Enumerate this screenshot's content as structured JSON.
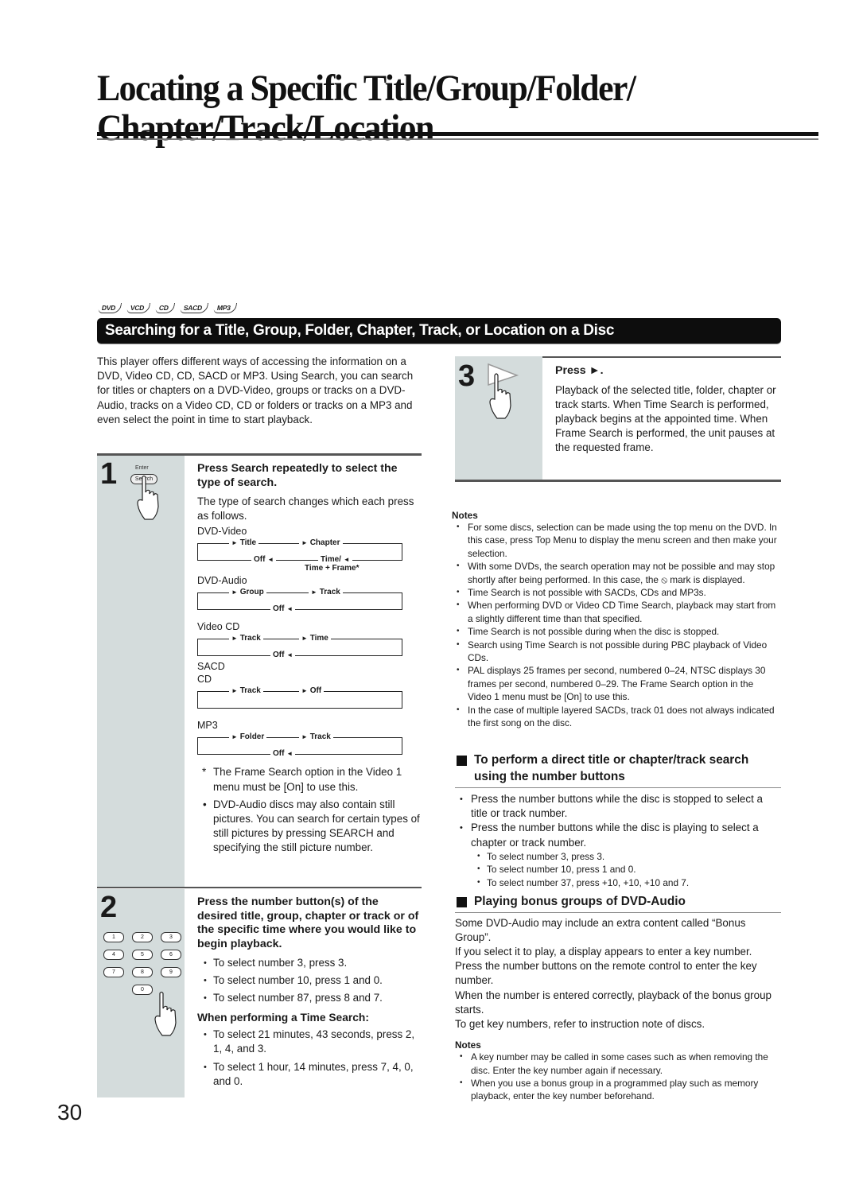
{
  "page": {
    "title_line1": "Locating a Specific Title/Group/Folder/",
    "title_line2": "Chapter/Track/Location",
    "page_number": "30"
  },
  "disc_badges": [
    "DVD",
    "VCD",
    "CD",
    "SACD",
    "MP3"
  ],
  "section": {
    "banner": "Searching for a Title, Group, Folder, Chapter, Track, or Location on a Disc",
    "intro": "This player offers different ways of accessing the information on a DVD, Video CD, CD, SACD or MP3. Using Search, you can search for titles or chapters on a DVD-Video, groups or tracks on a DVD-Audio, tracks on a Video CD, CD or folders or tracks on a MP3 and even select the point in time to start playback."
  },
  "step1": {
    "number": "1",
    "icon_label_top": "Enter",
    "icon_label_button": "Search",
    "heading": "Press Search repeatedly to select the type of search.",
    "text": "The type of search changes which each press as follows.",
    "sequences": [
      {
        "label": "DVD-Video",
        "items": [
          "Title",
          "Chapter"
        ],
        "return_items": [
          "Off",
          "Time/",
          "Time + Frame*"
        ]
      },
      {
        "label": "DVD-Audio",
        "items": [
          "Group",
          "Track"
        ],
        "return_items": [
          "Off"
        ]
      },
      {
        "label": "Video CD",
        "items": [
          "Track",
          "Time"
        ],
        "return_items": [
          "Off"
        ]
      },
      {
        "label": "SACD",
        "label2": "CD",
        "items": [
          "Track",
          "Off"
        ],
        "return_items": []
      },
      {
        "label": "MP3",
        "items": [
          "Folder",
          "Track"
        ],
        "return_items": [
          "Off"
        ]
      }
    ],
    "footnote": "The Frame Search option in the Video 1 menu must be [On] to use this.",
    "footnote_marker": "*",
    "bullet": "DVD-Audio discs may also contain still pictures. You can search for certain types of still pictures by pressing SEARCH and specifying the still picture number."
  },
  "step2": {
    "number": "2",
    "keys": [
      "1",
      "2",
      "3",
      "4",
      "5",
      "6",
      "7",
      "8",
      "9",
      "0"
    ],
    "heading": "Press the number button(s) of the desired title, group, chapter or track or of the specific time where you would like to begin playback.",
    "bullets": [
      "To select number 3, press 3.",
      "To select number 10, press 1 and 0.",
      "To select number 87, press 8 and 7."
    ],
    "time_heading": "When performing a Time Search:",
    "time_bullets": [
      "To select  21 minutes, 43 seconds, press 2, 1, 4, and 3.",
      "To select 1 hour, 14 minutes, press 7, 4, 0, and 0."
    ]
  },
  "step3": {
    "number": "3",
    "heading": "Press ►.",
    "text": "Playback of the selected title, folder, chapter or track starts. When Time Search is performed, playback begins at the appointed time. When Frame Search is performed, the unit pauses at the requested frame."
  },
  "notes1": {
    "title": "Notes",
    "items": [
      "For some discs, selection can be made using the top menu on the DVD. In this case, press Top Menu to display the menu screen and then make your selection.",
      "With some DVDs, the search operation may not be possible and may stop shortly after being performed. In this case, the ⦸ mark is displayed.",
      "Time Search is not possible with SACDs, CDs and MP3s.",
      "When performing DVD or Video CD Time Search, playback may start from a slightly different time than that specified.",
      "Time Search is not possible during when the disc is stopped.",
      "Search using Time Search is not possible during PBC playback of Video CDs.",
      "PAL displays 25 frames per second, numbered 0–24, NTSC displays 30 frames per second, numbered 0–29. The Frame Search option in the Video 1 menu must be [On] to use this.",
      "In the case of multiple layered SACDs, track 01 does not always indicated the first song on the disc."
    ]
  },
  "direct_search": {
    "heading": "To perform a direct title or chapter/track search using the number buttons",
    "bullets": [
      "Press the number buttons while the disc is stopped to select a title or track number.",
      "Press the number buttons while the disc is playing to select a chapter or track number."
    ],
    "sub_bullets": [
      "To select number 3, press 3.",
      "To select number 10, press 1 and 0.",
      "To select number 37, press +10, +10, +10 and 7."
    ]
  },
  "bonus": {
    "heading": "Playing bonus groups of DVD-Audio",
    "paragraphs": [
      "Some DVD-Audio may include an extra content called “Bonus Group”.",
      "If you select it to play, a display appears to enter a key number. Press the number buttons on the remote control to enter the key number.",
      "When the number is entered correctly, playback of the bonus group starts.",
      "To get key numbers, refer to instruction note of discs."
    ],
    "notes_title": "Notes",
    "notes": [
      "A key number may be called in some cases such as when removing the disc. Enter the key number again if necessary.",
      "When you use a bonus group in a programmed play such as memory playback, enter the key number beforehand."
    ]
  }
}
